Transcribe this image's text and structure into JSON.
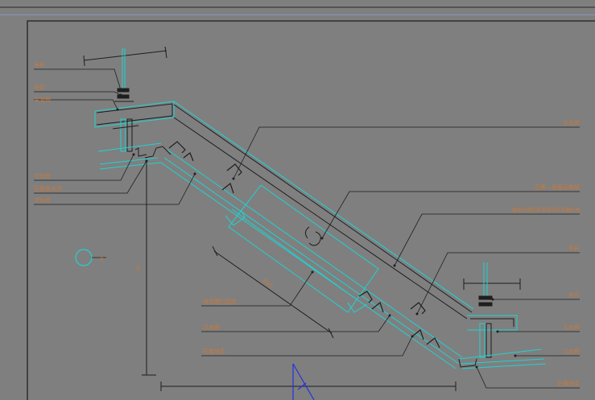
{
  "colors": {
    "background": "#7f7f7f",
    "frame": "#1a1a1a",
    "cyan": "#1fd3d3",
    "dark_line": "#1e1e1e",
    "label": "#c8793a",
    "ucs": "#2233dd",
    "top_rule": "#8c92c8"
  },
  "icons": {
    "ucs_icon": "ucs-triangle-icon",
    "section_marker": "circle-section-marker-icon"
  },
  "labels": {
    "left_top_1": "吊杆",
    "left_top_2": "吊件",
    "left_top_3": "主龙骨",
    "left_mid_1": "次龙骨",
    "left_mid_2": "石膏板吊顶",
    "left_mid_3": "次龙骨",
    "right_1": "主龙骨",
    "right_2": "石膏—纸面石膏板",
    "right_3": "面层处理乳胶漆或涂料饰面处理",
    "right_4": "吊杆",
    "right_5": "吊件",
    "right_6": "主龙骨",
    "right_7": "次龙骨",
    "right_8": "石膏线条",
    "bottom_1": "自攻螺钉固定",
    "bottom_2": "次龙骨",
    "bottom_3": "石膏线条",
    "slope_dim": "600",
    "vertical_dim": "H",
    "circle_tag": "A"
  }
}
